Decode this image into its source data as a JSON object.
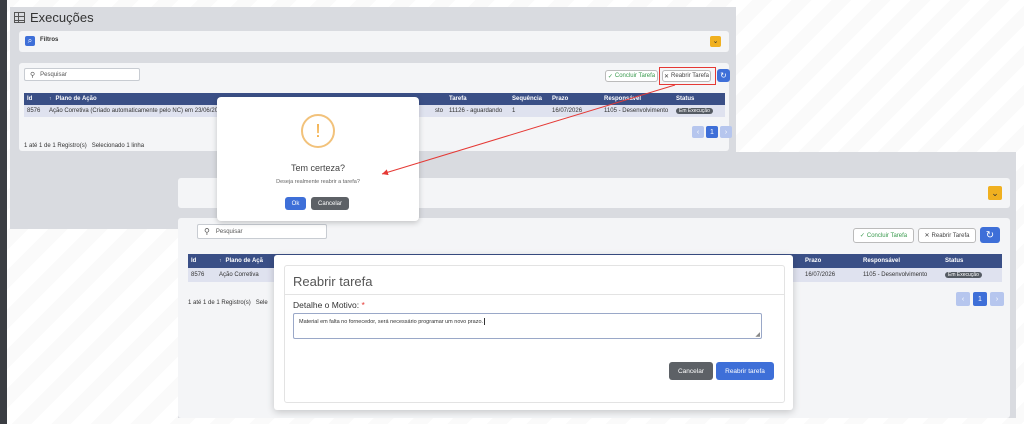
{
  "page": {
    "title": "Execuções"
  },
  "filters": {
    "label": "Filtros"
  },
  "search": {
    "placeholder": "Pesquisar"
  },
  "toolbar": {
    "conclude_label": "Concluir Tarefa",
    "reopen_label": "Reabrir Tarefa"
  },
  "table": {
    "headers": {
      "id": "Id",
      "plan": "Plano de Ação",
      "task": "Tarefa",
      "sequence": "Sequência",
      "deadline": "Prazo",
      "responsible": "Responsável",
      "status": "Status"
    },
    "headers_short": {
      "plan": "Plano de Açã"
    },
    "row": {
      "id": "8576",
      "plan": "Ação Corretiva (Criado automaticamente pelo NC) em 23/06/20",
      "plan_short": "Ação Corretiva",
      "task": "11126 - aguardando",
      "sequence": "1",
      "deadline": "16/07/2026",
      "responsible": "1105 - Desenvolvimento",
      "status": "Em Execução",
      "hidden_fragment": "sto"
    }
  },
  "footer": {
    "info": "1 até 1 de 1 Registro(s)   Selecionado 1 linha",
    "info_cut": "1 até 1 de 1 Registro(s)   Sele"
  },
  "pagination": {
    "prev": "‹",
    "current": "1",
    "next": "›"
  },
  "confirm_dialog": {
    "icon": "!",
    "title": "Tem certeza?",
    "text": "Deseja realmente reabrir a tarefa?",
    "ok_label": "Ok",
    "cancel_label": "Cancelar"
  },
  "reopen_modal": {
    "title": "Reabrir tarefa",
    "field_label": "Detalhe o Motivo:",
    "required_mark": "*",
    "reason_value": "Material em falta no fornecedor, será necessário programar um novo prazo.",
    "cancel_label": "Cancelar",
    "submit_label": "Reabrir tarefa"
  },
  "colors": {
    "primary": "#3e6fd8",
    "header": "#3a4f86",
    "accent_yellow": "#f0b020",
    "warning": "#f2a93b",
    "arrow_red": "#e53935",
    "success": "#4caf50"
  }
}
